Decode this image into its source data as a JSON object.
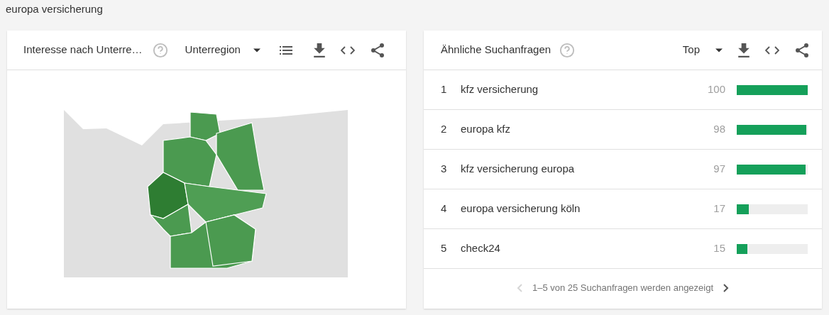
{
  "page_title": "europa versicherung",
  "region_card": {
    "title": "Interesse nach Unterre…",
    "dropdown": "Unterregion"
  },
  "related_card": {
    "title": "Ähnliche Suchanfragen",
    "dropdown": "Top",
    "rows": [
      {
        "rank": "1",
        "query": "kfz versicherung",
        "value": "100",
        "level": 1.0
      },
      {
        "rank": "2",
        "query": "europa kfz",
        "value": "98",
        "level": 0.98
      },
      {
        "rank": "3",
        "query": "kfz versicherung europa",
        "value": "97",
        "level": 0.97
      },
      {
        "rank": "4",
        "query": "europa versicherung köln",
        "value": "17",
        "level": 0.17
      },
      {
        "rank": "5",
        "query": "check24",
        "value": "15",
        "level": 0.15
      }
    ],
    "pager": {
      "text": "1–5 von 25 Suchanfragen werden angezeigt",
      "prev_disabled": true,
      "next_disabled": false
    }
  }
}
